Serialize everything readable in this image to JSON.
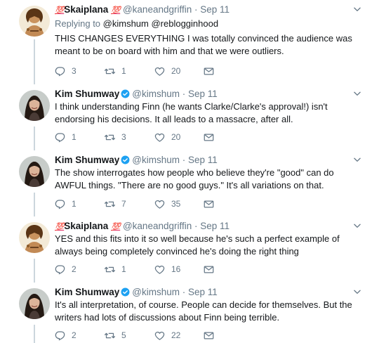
{
  "tweets": [
    {
      "name": "Skaiplana",
      "name_emoji_before": "💯",
      "name_emoji_after": "💯",
      "handle": "@kaneandgriffin",
      "date": "Sep 11",
      "verified": false,
      "replying_prefix": "Replying to ",
      "replying_to": "@kimshum @reblogginhood",
      "text": "THIS CHANGES EVERYTHING I was totally convinced the audience was meant to be on board with him and that we were outliers.",
      "replies": "3",
      "retweets": "1",
      "likes": "20"
    },
    {
      "name": "Kim Shumway",
      "handle": "@kimshum",
      "date": "Sep 11",
      "verified": true,
      "text": "I think understanding Finn (he wants Clarke/Clarke's approval!) isn't endorsing his decisions. It all leads to a massacre, after all.",
      "replies": "1",
      "retweets": "3",
      "likes": "20"
    },
    {
      "name": "Kim Shumway",
      "handle": "@kimshum",
      "date": "Sep 11",
      "verified": true,
      "text": "The show interrogates how people who believe they're \"good\" can do AWFUL things. \"There are no good guys.\" It's all variations on that.",
      "replies": "1",
      "retweets": "7",
      "likes": "35"
    },
    {
      "name": "Skaiplana",
      "name_emoji_before": "💯",
      "name_emoji_after": "💯",
      "handle": "@kaneandgriffin",
      "date": "Sep 11",
      "verified": false,
      "text": "YES and this fits into it so well because he's such a perfect example of always being completely convinced he's doing the right thing",
      "replies": "2",
      "retweets": "1",
      "likes": "16"
    },
    {
      "name": "Kim Shumway",
      "handle": "@kimshum",
      "date": "Sep 11",
      "verified": true,
      "text": "It's all interpretation, of course. People can decide for themselves. But the writers had lots of discussions about Finn being terrible.",
      "replies": "2",
      "retweets": "5",
      "likes": "22"
    }
  ],
  "separator": " · ",
  "colors": {
    "verified": "#1da1f2",
    "meta": "#657786",
    "thread_line": "#ccd6dd",
    "emoji": "#e0245e"
  },
  "icons": [
    "reply-icon",
    "retweet-icon",
    "like-icon",
    "direct-message-icon",
    "caret-down-icon",
    "verified-badge-icon"
  ]
}
